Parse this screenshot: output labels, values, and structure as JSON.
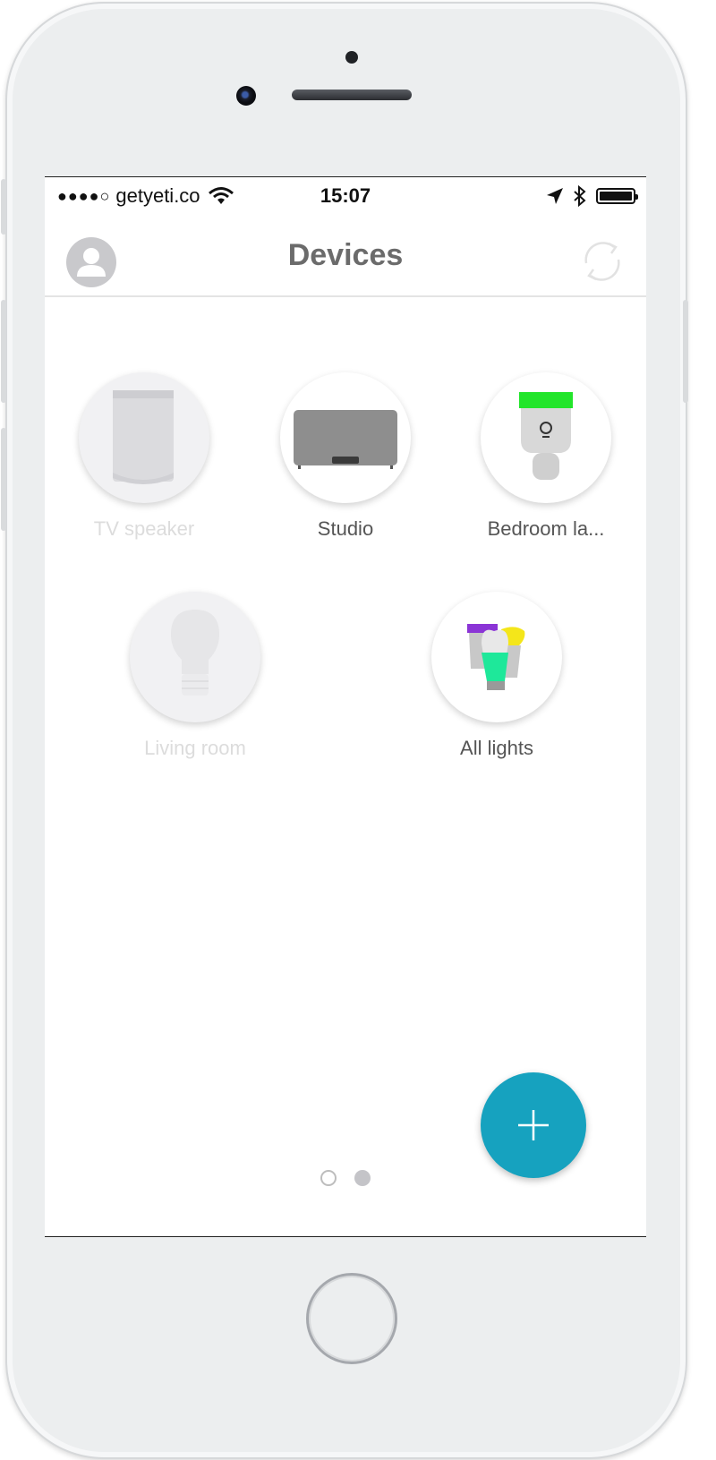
{
  "status": {
    "signal_dots": "●●●●○",
    "carrier": "getyeti.co",
    "time": "15:07"
  },
  "nav": {
    "title": "Devices"
  },
  "devices": [
    {
      "label": "TV speaker",
      "icon": "sonos-speaker-icon",
      "active": false
    },
    {
      "label": "Studio",
      "icon": "sonos-play5-icon",
      "active": true
    },
    {
      "label": "Bedroom la...",
      "icon": "lifx-bulb-icon",
      "active": true
    },
    {
      "label": "Living room",
      "icon": "wemo-bulb-icon",
      "active": false
    },
    {
      "label": "All lights",
      "icon": "multi-bulb-icon",
      "active": true
    }
  ],
  "pager": {
    "page_count": 2,
    "current_page": 2
  },
  "colors": {
    "accent": "#16a2bf",
    "title": "#6b6b6b",
    "lifx_top": "#22e52a",
    "bulb_purple": "#8b35d6",
    "bulb_yellow": "#f4e61a",
    "bulb_green": "#1ee89a"
  }
}
